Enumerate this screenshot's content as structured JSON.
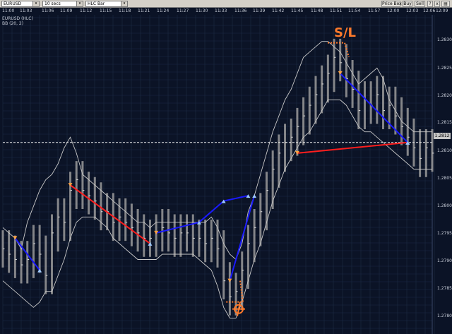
{
  "toolbar": {
    "symbol": "EURUSD",
    "interval": "10 secs",
    "bar_type": "HLC Bar",
    "buttons": [
      "Price Box",
      "Buy",
      "Sell"
    ],
    "icon_buttons": [
      "?",
      "x"
    ]
  },
  "time_axis": [
    "11:00",
    "11:03",
    "11:06",
    "11:09",
    "11:12",
    "11:15",
    "11:18",
    "11:21",
    "11:24",
    "11:27",
    "11:30",
    "11:33",
    "11:36",
    "11:39",
    "11:42",
    "11:45",
    "11:48",
    "11:51",
    "11:54",
    "11:57",
    "12:00",
    "12:03",
    "12:06",
    "12:09"
  ],
  "chart_info": {
    "series": "EURUSD (HLC)",
    "indicator": "BB (20, 2)"
  },
  "price_axis": [
    "1.2830",
    "1.2825",
    "1.2820",
    "1.2815",
    "1.2810",
    "1.2805",
    "1.2800",
    "1.2795",
    "1.2790",
    "1.2785",
    "1.2780"
  ],
  "current_price": "1.2812",
  "annotations": {
    "stop_loss": "S/L"
  },
  "colors": {
    "background": "#0b1326",
    "grid": "#1d2a44",
    "bars": "#9a9a9a",
    "bands": "#c8c8c8",
    "sell_line": "#ff1e1e",
    "buy_line": "#1a1aff",
    "markers": "#ffa040",
    "stop_loss": "#ff7a2b"
  },
  "chart_data": {
    "type": "line",
    "title": "",
    "xlabel": "",
    "ylabel": "",
    "x": [
      "11:00",
      "11:01",
      "11:02",
      "11:03",
      "11:04",
      "11:05",
      "11:06",
      "11:07",
      "11:08",
      "11:09",
      "11:10",
      "11:11",
      "11:12",
      "11:13",
      "11:14",
      "11:15",
      "11:16",
      "11:17",
      "11:18",
      "11:19",
      "11:20",
      "11:21",
      "11:22",
      "11:23",
      "11:24",
      "11:25",
      "11:26",
      "11:27",
      "11:28",
      "11:29",
      "11:30",
      "11:31",
      "11:32",
      "11:33",
      "11:34",
      "11:35",
      "11:36",
      "11:37",
      "11:38",
      "11:39",
      "11:40",
      "11:41",
      "11:42",
      "11:43",
      "11:44",
      "11:45",
      "11:46",
      "11:47",
      "11:48",
      "11:49",
      "11:50",
      "11:51",
      "11:52",
      "11:53",
      "11:54",
      "11:55",
      "11:56",
      "11:57",
      "11:58",
      "11:59",
      "12:00",
      "12:01",
      "12:02",
      "12:03",
      "12:04",
      "12:05",
      "12:06",
      "12:07",
      "12:08",
      "12:09",
      "12:10"
    ],
    "ylim": [
      1.2776,
      1.2836
    ],
    "series": [
      {
        "name": "EURUSD (HLC)",
        "values": [
          1.2792,
          1.2791,
          1.279,
          1.2789,
          1.279,
          1.2793,
          1.2791,
          1.2787,
          1.2795,
          1.2798,
          1.2797,
          1.2803,
          1.2805,
          1.2803,
          1.2802,
          1.2801,
          1.2799,
          1.2799,
          1.2797,
          1.2798,
          1.2797,
          1.2796,
          1.2795,
          1.2794,
          1.2794,
          1.2795,
          1.2796,
          1.2795,
          1.2794,
          1.2795,
          1.2795,
          1.2794,
          1.2794,
          1.2793,
          1.2794,
          1.2792,
          1.2786,
          1.2783,
          1.2784,
          1.2788,
          1.2793,
          1.2796,
          1.2799,
          1.2803,
          1.2807,
          1.281,
          1.2812,
          1.2813,
          1.2815,
          1.2817,
          1.2819,
          1.2821,
          1.2823,
          1.2825,
          1.2828,
          1.2827,
          1.2824,
          1.2822,
          1.2818,
          1.282,
          1.2819,
          1.2821,
          1.2818,
          1.2819,
          1.2817,
          1.2815,
          1.2813,
          1.2811,
          1.2809,
          1.2811,
          1.281
        ]
      },
      {
        "name": "",
        "values": [
          1.2796,
          1.2795,
          1.2794,
          1.2792,
          1.2797,
          1.28,
          1.2803,
          1.2805,
          1.2806,
          1.2808,
          1.2811,
          1.2813,
          1.281,
          1.2806,
          1.2805,
          1.2804,
          1.2803,
          1.2802,
          1.2801,
          1.28,
          1.2799,
          1.2798,
          1.2797,
          1.2797,
          1.2796,
          1.2797,
          1.2797,
          1.2797,
          1.2797,
          1.2797,
          1.2797,
          1.2797,
          1.2797,
          1.2797,
          1.2798,
          1.2796,
          1.2793,
          1.2791,
          1.279,
          1.2793,
          1.2799,
          1.2802,
          1.2806,
          1.281,
          1.2814,
          1.2817,
          1.282,
          1.2822,
          1.2825,
          1.2828,
          1.2829,
          1.283,
          1.2831,
          1.2831,
          1.283,
          1.2829,
          1.2827,
          1.2825,
          1.2823,
          1.2824,
          1.2825,
          1.2826,
          1.2824,
          1.282,
          1.2818,
          1.2816,
          1.2815,
          1.2814,
          1.2814,
          1.2814,
          1.2814
        ]
      },
      {
        "name": "",
        "values": [
          1.2786,
          1.2785,
          1.2784,
          1.2783,
          1.2782,
          1.2781,
          1.2782,
          1.2784,
          1.2784,
          1.2787,
          1.279,
          1.2794,
          1.2797,
          1.2798,
          1.2798,
          1.2798,
          1.2797,
          1.2796,
          1.2794,
          1.2793,
          1.2792,
          1.2791,
          1.279,
          1.279,
          1.279,
          1.279,
          1.2791,
          1.2791,
          1.2791,
          1.2791,
          1.2791,
          1.2791,
          1.279,
          1.2789,
          1.2788,
          1.2785,
          1.2781,
          1.2779,
          1.2779,
          1.2782,
          1.2786,
          1.279,
          1.2793,
          1.2797,
          1.2801,
          1.2804,
          1.2807,
          1.2809,
          1.2811,
          1.2813,
          1.2814,
          1.2816,
          1.2818,
          1.282,
          1.282,
          1.282,
          1.2819,
          1.2817,
          1.2815,
          1.2814,
          1.2814,
          1.2813,
          1.2812,
          1.2811,
          1.281,
          1.2809,
          1.2808,
          1.2807,
          1.2807,
          1.2807,
          1.2807
        ]
      }
    ],
    "trades": [
      {
        "color": "red",
        "points": [
          [
            "11:11",
            1.2804
          ],
          [
            "11:24",
            1.2793
          ]
        ]
      },
      {
        "color": "red",
        "points": [
          [
            "11:48",
            1.281
          ],
          [
            "12:06",
            1.2812
          ]
        ]
      },
      {
        "color": "blue",
        "points": [
          [
            "11:02",
            1.2794
          ],
          [
            "11:06",
            1.2788
          ]
        ]
      },
      {
        "color": "blue",
        "points": [
          [
            "11:25",
            1.2795
          ],
          [
            "11:32",
            1.2797
          ],
          [
            "11:36",
            1.2801
          ],
          [
            "11:40",
            1.2802
          ]
        ]
      },
      {
        "color": "blue",
        "points": [
          [
            "11:37",
            1.2786
          ],
          [
            "11:41",
            1.2802
          ]
        ]
      },
      {
        "color": "blue",
        "points": [
          [
            "11:55",
            1.2825
          ],
          [
            "12:06",
            1.2812
          ]
        ]
      }
    ],
    "grid": true
  }
}
